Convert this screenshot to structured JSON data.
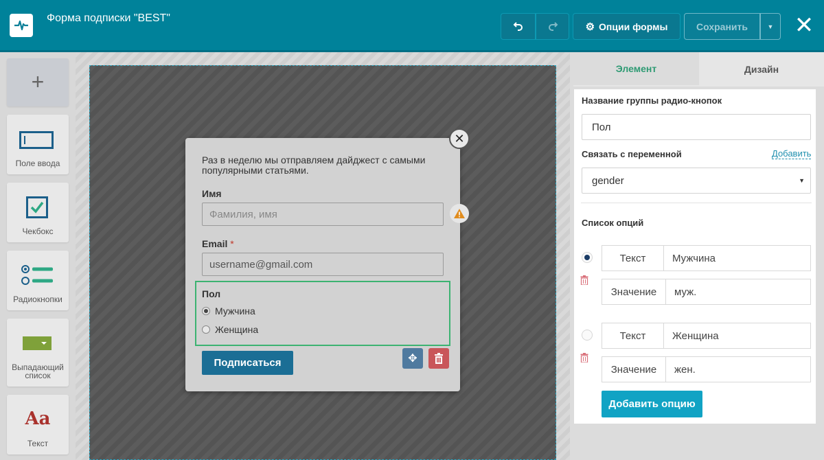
{
  "header": {
    "title": "Форма подписки \"BEST\"",
    "options_label": "Опции формы",
    "save_label": "Сохранить"
  },
  "palette": {
    "add_symbol": "+",
    "items": [
      {
        "label": "Поле ввода"
      },
      {
        "label": "Чекбокс"
      },
      {
        "label": "Радиокнопки"
      },
      {
        "label": "Выпадающий список"
      },
      {
        "label": "Текст"
      }
    ],
    "text_icon": "Aa"
  },
  "form": {
    "intro": "Раз в неделю мы отправляем дайджест с самыми популярными статьями.",
    "name_label": "Имя",
    "name_placeholder": "Фамилия, имя",
    "email_label": "Email",
    "email_required": "*",
    "email_placeholder": "username@gmail.com",
    "radio_title": "Пол",
    "radio_options": [
      "Мужчина",
      "Женщина"
    ],
    "submit_label": "Подписаться"
  },
  "panel": {
    "tabs": [
      "Элемент",
      "Дизайн"
    ],
    "group_name_label": "Название группы радио-кнопок",
    "group_name_value": "Пол",
    "variable_label": "Связать с переменной",
    "variable_add": "Добавить",
    "variable_value": "gender",
    "options_title": "Список опций",
    "options": [
      {
        "text_key": "Текст",
        "text": "Мужчина",
        "value_key": "Значение",
        "value": "муж."
      },
      {
        "text_key": "Текст",
        "text": "Женщина",
        "value_key": "Значение",
        "value": "жен."
      }
    ],
    "add_option_label": "Добавить опцию"
  }
}
